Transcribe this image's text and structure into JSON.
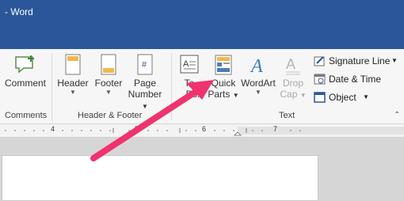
{
  "app": {
    "title": "- Word"
  },
  "ribbon": {
    "comment_label": "Comment",
    "header_label": "Header",
    "footer_label": "Footer",
    "page_number_label_line1": "Page",
    "page_number_label_line2": "Number",
    "textbox_line1": "Te",
    "textbox_line2": "Box",
    "quickparts_line1": "Quick",
    "quickparts_line2": "Parts",
    "wordart_label": "WordArt",
    "dropcap_line1": "Drop",
    "dropcap_line2": "Cap",
    "signature_line_label": "Signature Line",
    "date_time_label": "Date & Time",
    "object_label": "Object",
    "groups": {
      "comments": "Comments",
      "header_footer": "Header & Footer",
      "text": "Text"
    }
  },
  "ruler": {
    "labels": [
      "4",
      "5",
      "6",
      "7"
    ]
  },
  "colors": {
    "title_bar": "#2b579a",
    "annotation_arrow": "#f0326e"
  },
  "icons": {
    "comment": "comment-icon",
    "header": "header-icon",
    "footer": "footer-icon",
    "page_number": "page-number-icon",
    "textbox": "textbox-icon",
    "quickparts": "quickparts-icon",
    "wordart": "wordart-icon",
    "dropcap": "dropcap-icon",
    "signature_line": "signature-line-icon",
    "date_time": "date-time-icon",
    "object": "object-icon"
  }
}
